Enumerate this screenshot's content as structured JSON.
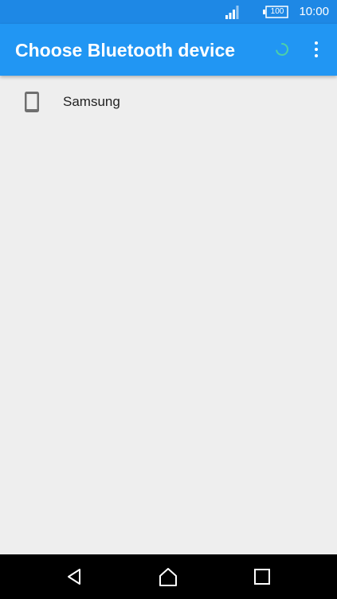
{
  "status_bar": {
    "battery_level": "100",
    "time": "10:00",
    "icons": [
      "signal-icon",
      "battery-icon"
    ]
  },
  "app_bar": {
    "title": "Choose Bluetooth device",
    "icons": [
      "spinner-icon",
      "more-vert-icon"
    ],
    "accent": "#2196f3",
    "status_color": "#1e88e5"
  },
  "devices": [
    {
      "label": "Samsung",
      "icon": "smartphone-icon"
    }
  ],
  "nav_bar": {
    "buttons": [
      "back-icon",
      "home-icon",
      "recents-icon"
    ]
  }
}
